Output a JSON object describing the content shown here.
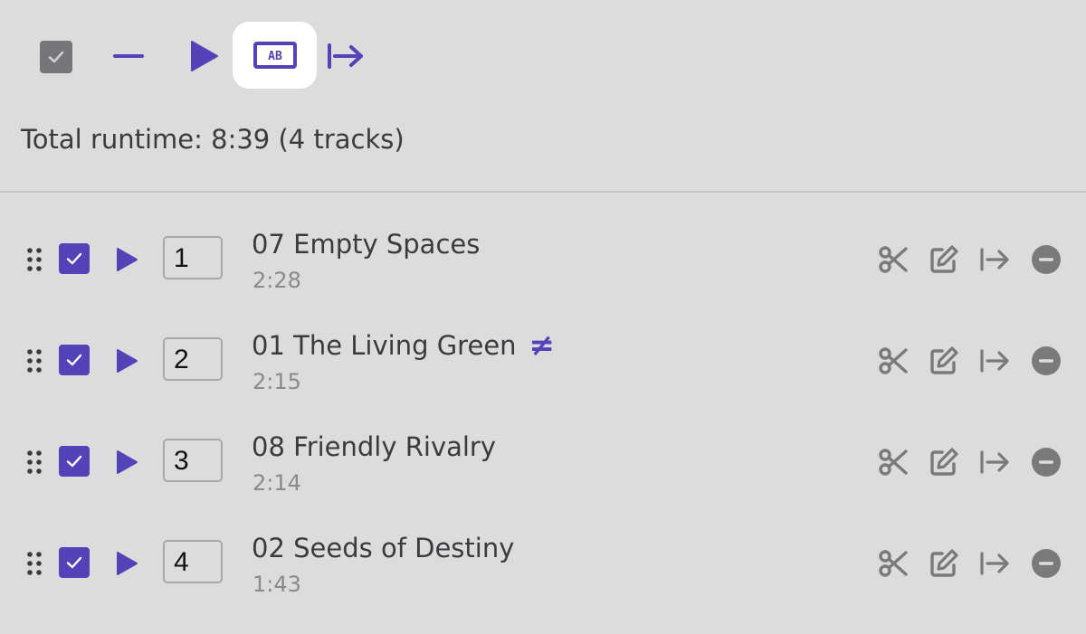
{
  "toolbar": {
    "select_all_icon": "checkbox-icon",
    "deselect_icon": "minus-icon",
    "play_icon": "play-icon",
    "ab_mode_icon": "ab-icon",
    "move_icon": "arrow-right-to-bar-icon",
    "ab_label": "AB",
    "accent_color": "#5342b8"
  },
  "summary": {
    "text": "Total runtime: 8:39 (4 tracks)"
  },
  "tracks": [
    {
      "order": "1",
      "title": "07 Empty Spaces",
      "duration": "2:28",
      "mismatch": ""
    },
    {
      "order": "2",
      "title": "01 The Living Green",
      "duration": "2:15",
      "mismatch": "≠"
    },
    {
      "order": "3",
      "title": "08 Friendly Rivalry",
      "duration": "2:14",
      "mismatch": ""
    },
    {
      "order": "4",
      "title": "02 Seeds of Destiny",
      "duration": "1:43",
      "mismatch": ""
    }
  ],
  "row_actions": {
    "cut_icon": "scissors-icon",
    "edit_icon": "edit-icon",
    "move_icon": "arrow-right-to-bar-icon",
    "remove_icon": "minus-circle-icon"
  }
}
